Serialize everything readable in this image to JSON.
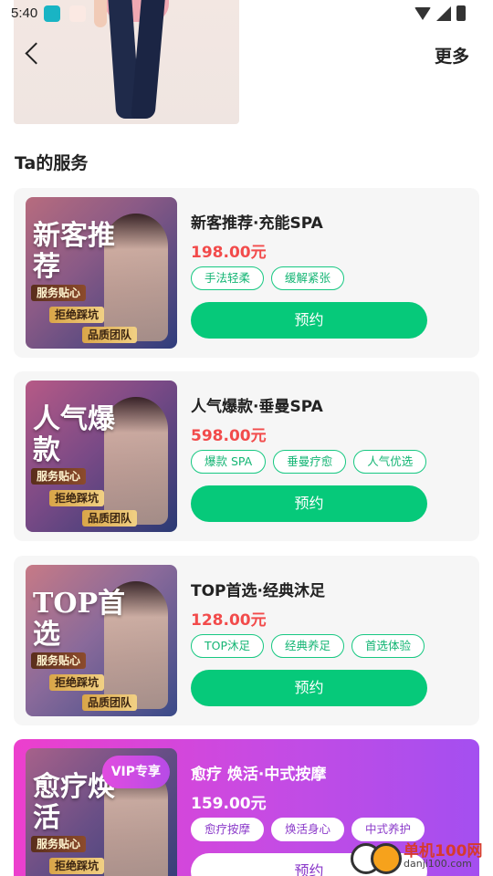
{
  "status_bar": {
    "time": "5:40"
  },
  "header": {
    "more_label": "更多"
  },
  "section": {
    "title": "Ta的服务"
  },
  "services": [
    {
      "title": "新客推荐·充能SPA",
      "price": "198.00元",
      "tags": [
        "手法轻柔",
        "缓解紧张"
      ],
      "book_label": "预约",
      "thumb": {
        "headline": "新客推荐",
        "badges": [
          "服务贴心",
          "拒绝踩坑",
          "品质团队"
        ],
        "colors": [
          "#b76c7e",
          "#2f3d7c"
        ]
      }
    },
    {
      "title": "人气爆款·垂曼SPA",
      "price": "598.00元",
      "tags": [
        "爆款 SPA",
        "垂曼疗愈",
        "人气优选"
      ],
      "book_label": "预约",
      "thumb": {
        "headline": "人气爆款",
        "badges": [
          "服务贴心",
          "拒绝踩坑",
          "品质团队"
        ],
        "colors": [
          "#b65a86",
          "#2a3a74"
        ]
      }
    },
    {
      "title": "TOP首选·经典沐足",
      "price": "128.00元",
      "tags": [
        "TOP沐足",
        "经典养足",
        "首选体验"
      ],
      "book_label": "预约",
      "thumb": {
        "headline": "TOP首选",
        "badges": [
          "服务贴心",
          "拒绝踩坑",
          "品质团队"
        ],
        "colors": [
          "#c77a86",
          "#3a4a88"
        ]
      }
    },
    {
      "title": "愈疗 焕活·中式按摩",
      "price": "159.00元",
      "tags": [
        "愈疗按摩",
        "焕活身心",
        "中式养护"
      ],
      "book_label": "预约",
      "thumb": {
        "headline": "愈疗焕活",
        "badges": [
          "服务贴心",
          "拒绝踩坑"
        ],
        "vip_label": "VIP专享",
        "colors": [
          "#a7618a",
          "#2e3d77"
        ]
      }
    }
  ],
  "watermark": {
    "name": "单机100网",
    "url": "danji100.com"
  }
}
